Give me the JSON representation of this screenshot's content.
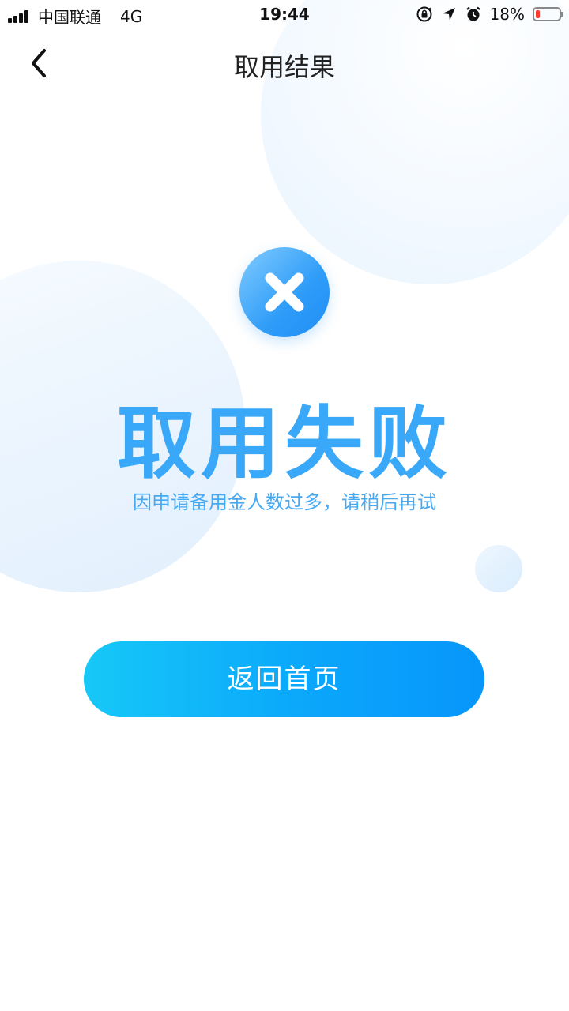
{
  "status_bar": {
    "carrier": "中国联通",
    "network": "4G",
    "time": "19:44",
    "battery_percent": "18%",
    "battery_level": 0.18,
    "battery_color": "#ff3b30"
  },
  "nav": {
    "back_icon": "chevron-left-icon",
    "title": "取用结果"
  },
  "result": {
    "icon": "close-circle-icon",
    "title": "取用失败",
    "message": "因申请备用金人数过多，请稍后再试"
  },
  "actions": {
    "home_button_label": "返回首页"
  },
  "colors": {
    "accent": "#3aa8f8",
    "button_gradient_start": "#16c8f7",
    "button_gradient_end": "#0796fb"
  }
}
